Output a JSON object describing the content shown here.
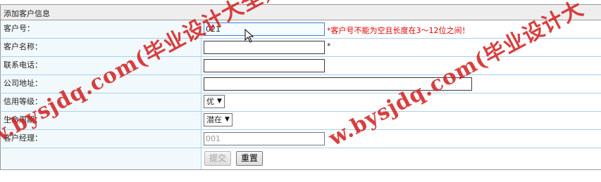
{
  "form": {
    "title": "添加客户信息",
    "fields": {
      "customer_no": {
        "label": "客户号：",
        "value": "021",
        "error": "*客户号不能为空且长度在3～12位之间！"
      },
      "customer_name": {
        "label": "客户名称：",
        "value": "",
        "required_mark": "*"
      },
      "phone": {
        "label": "联系电话：",
        "value": ""
      },
      "address": {
        "label": "公司地址：",
        "value": ""
      },
      "credit": {
        "label": "信用等级：",
        "selected": "优"
      },
      "lifecycle": {
        "label": "生命周期：",
        "selected": "潜在"
      },
      "manager": {
        "label": "客户经理：",
        "value": "001"
      }
    },
    "buttons": {
      "submit": "提交",
      "reset": "重置"
    }
  },
  "watermark": {
    "text_left": "w.bysjdq.com(毕业设计大全)",
    "text_right": "w.bysjdq.com(毕业设计大",
    "color": "#d21f1f"
  },
  "colors": {
    "error": "#e00000",
    "label_bg": "#f2f9fc",
    "header_bg": "#eeeeee",
    "row_border": "#a9d0ea"
  }
}
